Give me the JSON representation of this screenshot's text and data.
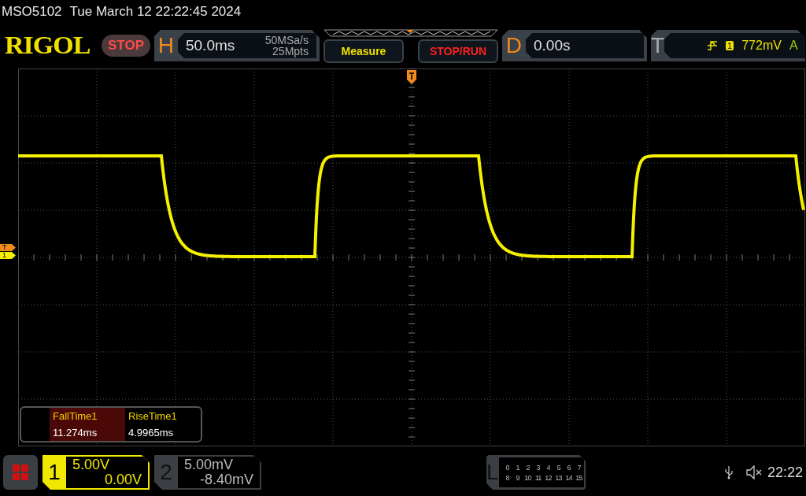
{
  "header": {
    "model": "MSO5102",
    "datetime": "Tue March 12 22:22:45 2024"
  },
  "toolbar": {
    "logo": "RIGOL",
    "run_state": "STOP",
    "horizontal": {
      "letter": "H",
      "timebase": "50.0ms",
      "sample_rate": "50MSa/s",
      "memory_depth": "25Mpts"
    },
    "buttons": [
      {
        "label": "Measure",
        "kind": "measure"
      },
      {
        "label": "STOP/RUN",
        "kind": "run"
      }
    ],
    "delay": {
      "letter": "D",
      "value": "0.00s"
    },
    "trigger": {
      "letter": "T",
      "source": "1",
      "level": "772mV",
      "mode": "A"
    }
  },
  "screen": {
    "markers": [
      {
        "label": "T",
        "color": "#f08a1c"
      },
      {
        "label": "1",
        "color": "#f5f000"
      }
    ],
    "measurements": [
      {
        "name": "FallTime1",
        "value": "11.274ms",
        "selected": true
      },
      {
        "name": "RiseTime1",
        "value": "4.9965ms",
        "selected": false
      }
    ]
  },
  "channels": [
    {
      "number": "1",
      "scale": "5.00V",
      "offset": "0.00V",
      "selected": true
    },
    {
      "number": "2",
      "scale": "5.00mV",
      "offset": "-8.40mV",
      "selected": false
    }
  ],
  "logic": {
    "letter": "L",
    "rows": [
      [
        "0",
        "1",
        "2",
        "3",
        "4",
        "5",
        "6",
        "7"
      ],
      [
        "8",
        "9",
        "10",
        "11",
        "12",
        "13",
        "14",
        "15"
      ]
    ]
  },
  "status": {
    "time": "22:22",
    "muted": true
  }
}
